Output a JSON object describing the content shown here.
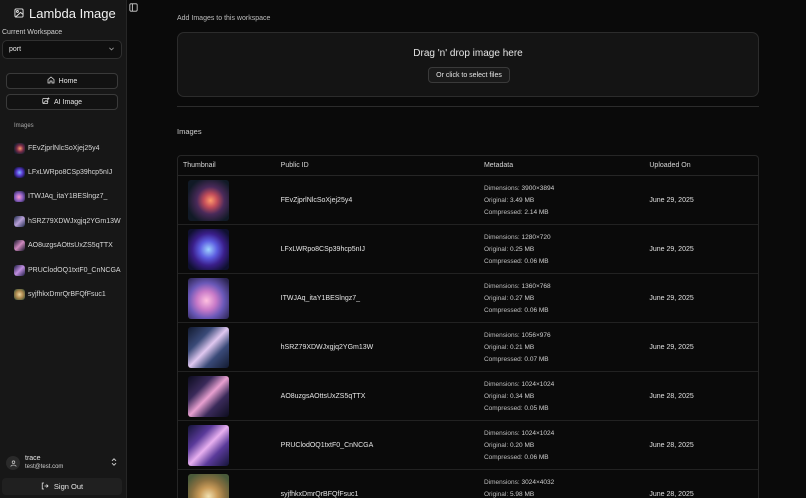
{
  "app": {
    "title": "Lambda Image"
  },
  "workspace": {
    "label": "Current Workspace",
    "selected": "port"
  },
  "nav": {
    "home": "Home",
    "ai_image": "AI Image"
  },
  "sidebar": {
    "section_label": "Images",
    "items": [
      {
        "label": "FEvZjprlNlcSoXjej25y4"
      },
      {
        "label": "LFxLWRpo8CSp39hcp5nIJ"
      },
      {
        "label": "ITWJAq_itaY1BESlngz7_"
      },
      {
        "label": "hSRZ79XDWJxgjq2YGm13W"
      },
      {
        "label": "AO8uzgsAOttsUxZS5qTTX"
      },
      {
        "label": "PRUClodOQ1txtF0_CnNCGA"
      },
      {
        "label": "syjfhkxDmrQrBFQfFsuc1"
      }
    ]
  },
  "user": {
    "name": "trace",
    "email": "test@test.com"
  },
  "signout": {
    "label": "Sign Out"
  },
  "upload": {
    "header": "Add Images to this workspace",
    "drop_title": "Drag 'n' drop image here",
    "select_button": "Or click to select files"
  },
  "images_section": {
    "label": "Images"
  },
  "table": {
    "columns": [
      "Thumbnail",
      "Public ID",
      "Metadata",
      "Uploaded On"
    ],
    "meta_labels": {
      "dimensions": "Dimensions:",
      "original": "Original:",
      "compressed": "Compressed:"
    },
    "rows": [
      {
        "public_id": "FEvZjprlNlcSoXjej25y4",
        "dimensions": "3900×3894",
        "original": "3.49 MB",
        "compressed": "2.14 MB",
        "uploaded": "June 29, 2025"
      },
      {
        "public_id": "LFxLWRpo8CSp39hcp5nIJ",
        "dimensions": "1280×720",
        "original": "0.25 MB",
        "compressed": "0.06 MB",
        "uploaded": "June 29, 2025"
      },
      {
        "public_id": "ITWJAq_itaY1BESlngz7_",
        "dimensions": "1360×768",
        "original": "0.27 MB",
        "compressed": "0.06 MB",
        "uploaded": "June 29, 2025"
      },
      {
        "public_id": "hSRZ79XDWJxgjq2YGm13W",
        "dimensions": "1056×976",
        "original": "0.21 MB",
        "compressed": "0.07 MB",
        "uploaded": "June 29, 2025"
      },
      {
        "public_id": "AO8uzgsAOttsUxZS5qTTX",
        "dimensions": "1024×1024",
        "original": "0.34 MB",
        "compressed": "0.05 MB",
        "uploaded": "June 28, 2025"
      },
      {
        "public_id": "PRUClodOQ1txtF0_CnNCGA",
        "dimensions": "1024×1024",
        "original": "0.20 MB",
        "compressed": "0.06 MB",
        "uploaded": "June 28, 2025"
      },
      {
        "public_id": "syjfhkxDmrQrBFQfFsuc1",
        "dimensions": "3024×4032",
        "original": "5.98 MB",
        "compressed": "",
        "uploaded": "June 28, 2025"
      }
    ]
  },
  "colors": {
    "background": "#0a0a0a",
    "sidebar": "#171717",
    "border": "#262626",
    "text": "#e6e6e6"
  },
  "icons": {
    "brand": "image-icon",
    "select": "chevron-down-icon",
    "home": "home-icon",
    "ai": "image-plus-icon",
    "toggle": "sidebar-toggle-icon",
    "avatar": "user-icon",
    "user_menu": "chevrons-up-down-icon",
    "signout": "logout-icon"
  }
}
